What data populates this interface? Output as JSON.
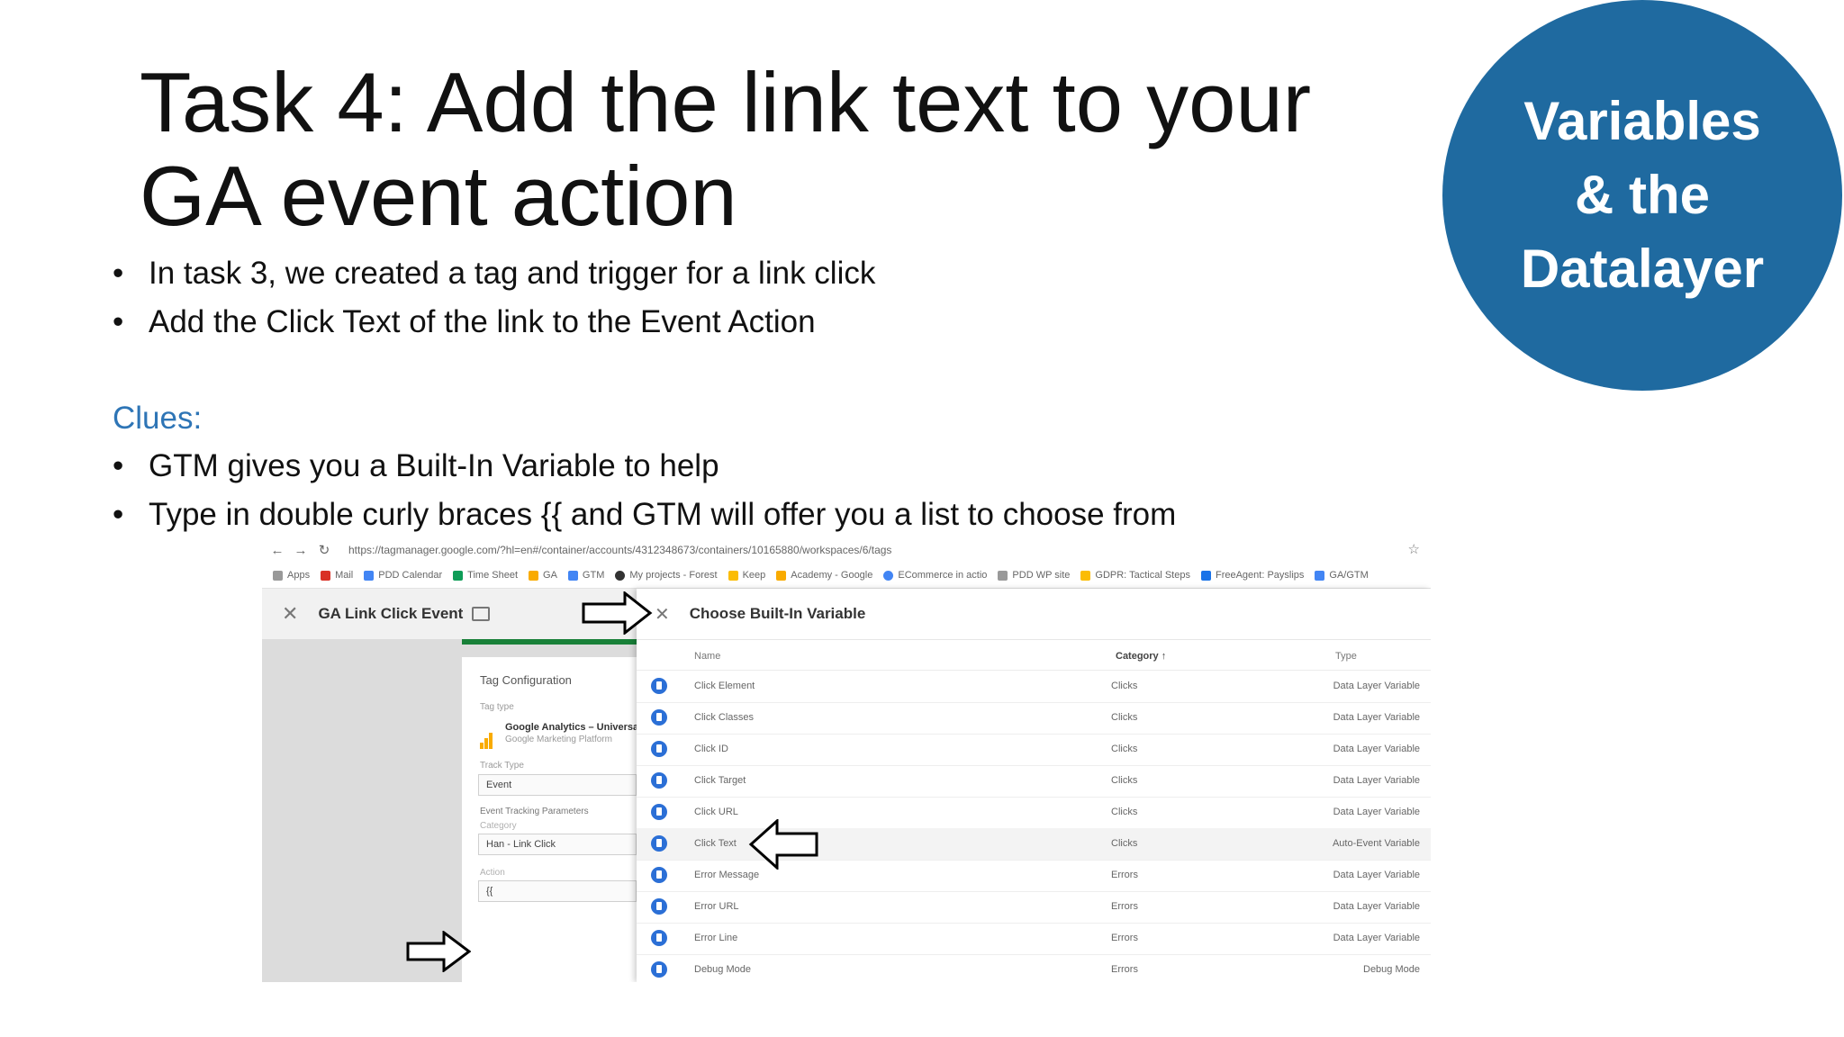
{
  "slide": {
    "title": "Task 4: Add the link text to your GA event action",
    "bullets_a": [
      "In task 3, we created a tag and trigger for a link click",
      "Add the Click Text of the link to the Event Action"
    ],
    "clues_label": "Clues:",
    "bullets_b": [
      "GTM gives you a Built-In Variable to help",
      "Type in double curly braces {{ and GTM will offer you a list to choose from"
    ],
    "badge": [
      "Variables",
      "& the",
      "Datalayer"
    ],
    "badge_color": "#1f6aa0",
    "clues_color": "#2e75b6"
  },
  "browser": {
    "url": "https://tagmanager.google.com/?hl=en#/container/accounts/4312348673/containers/10165880/workspaces/6/tags",
    "bookmarks": [
      "Apps",
      "Mail",
      "PDD Calendar",
      "Time Sheet",
      "GA",
      "GTM",
      "My projects - Forest",
      "Keep",
      "Academy - Google",
      "ECommerce in actio",
      "PDD WP site",
      "GDPR: Tactical Steps",
      "FreeAgent: Payslips",
      "GA/GTM"
    ]
  },
  "tag_editor": {
    "title": "GA Link Click Event",
    "section": "Tag Configuration",
    "tag_type_label": "Tag type",
    "tag_type_name": "Google Analytics – Universal",
    "tag_type_sub": "Google Marketing Platform",
    "track_type_label": "Track Type",
    "track_type_value": "Event",
    "params_label": "Event Tracking Parameters",
    "category_label": "Category",
    "category_value": "Han - Link Click",
    "action_label": "Action",
    "action_value": "{{"
  },
  "chooser": {
    "title": "Choose Built-In Variable",
    "columns": {
      "name": "Name",
      "category": "Category ↑",
      "type": "Type"
    },
    "rows": [
      {
        "name": "Click Element",
        "category": "Clicks",
        "type": "Data Layer Variable"
      },
      {
        "name": "Click Classes",
        "category": "Clicks",
        "type": "Data Layer Variable"
      },
      {
        "name": "Click ID",
        "category": "Clicks",
        "type": "Data Layer Variable"
      },
      {
        "name": "Click Target",
        "category": "Clicks",
        "type": "Data Layer Variable"
      },
      {
        "name": "Click URL",
        "category": "Clicks",
        "type": "Data Layer Variable"
      },
      {
        "name": "Click Text",
        "category": "Clicks",
        "type": "Auto-Event Variable"
      },
      {
        "name": "Error Message",
        "category": "Errors",
        "type": "Data Layer Variable"
      },
      {
        "name": "Error URL",
        "category": "Errors",
        "type": "Data Layer Variable"
      },
      {
        "name": "Error Line",
        "category": "Errors",
        "type": "Data Layer Variable"
      },
      {
        "name": "Debug Mode",
        "category": "Errors",
        "type": "Debug Mode"
      }
    ]
  }
}
